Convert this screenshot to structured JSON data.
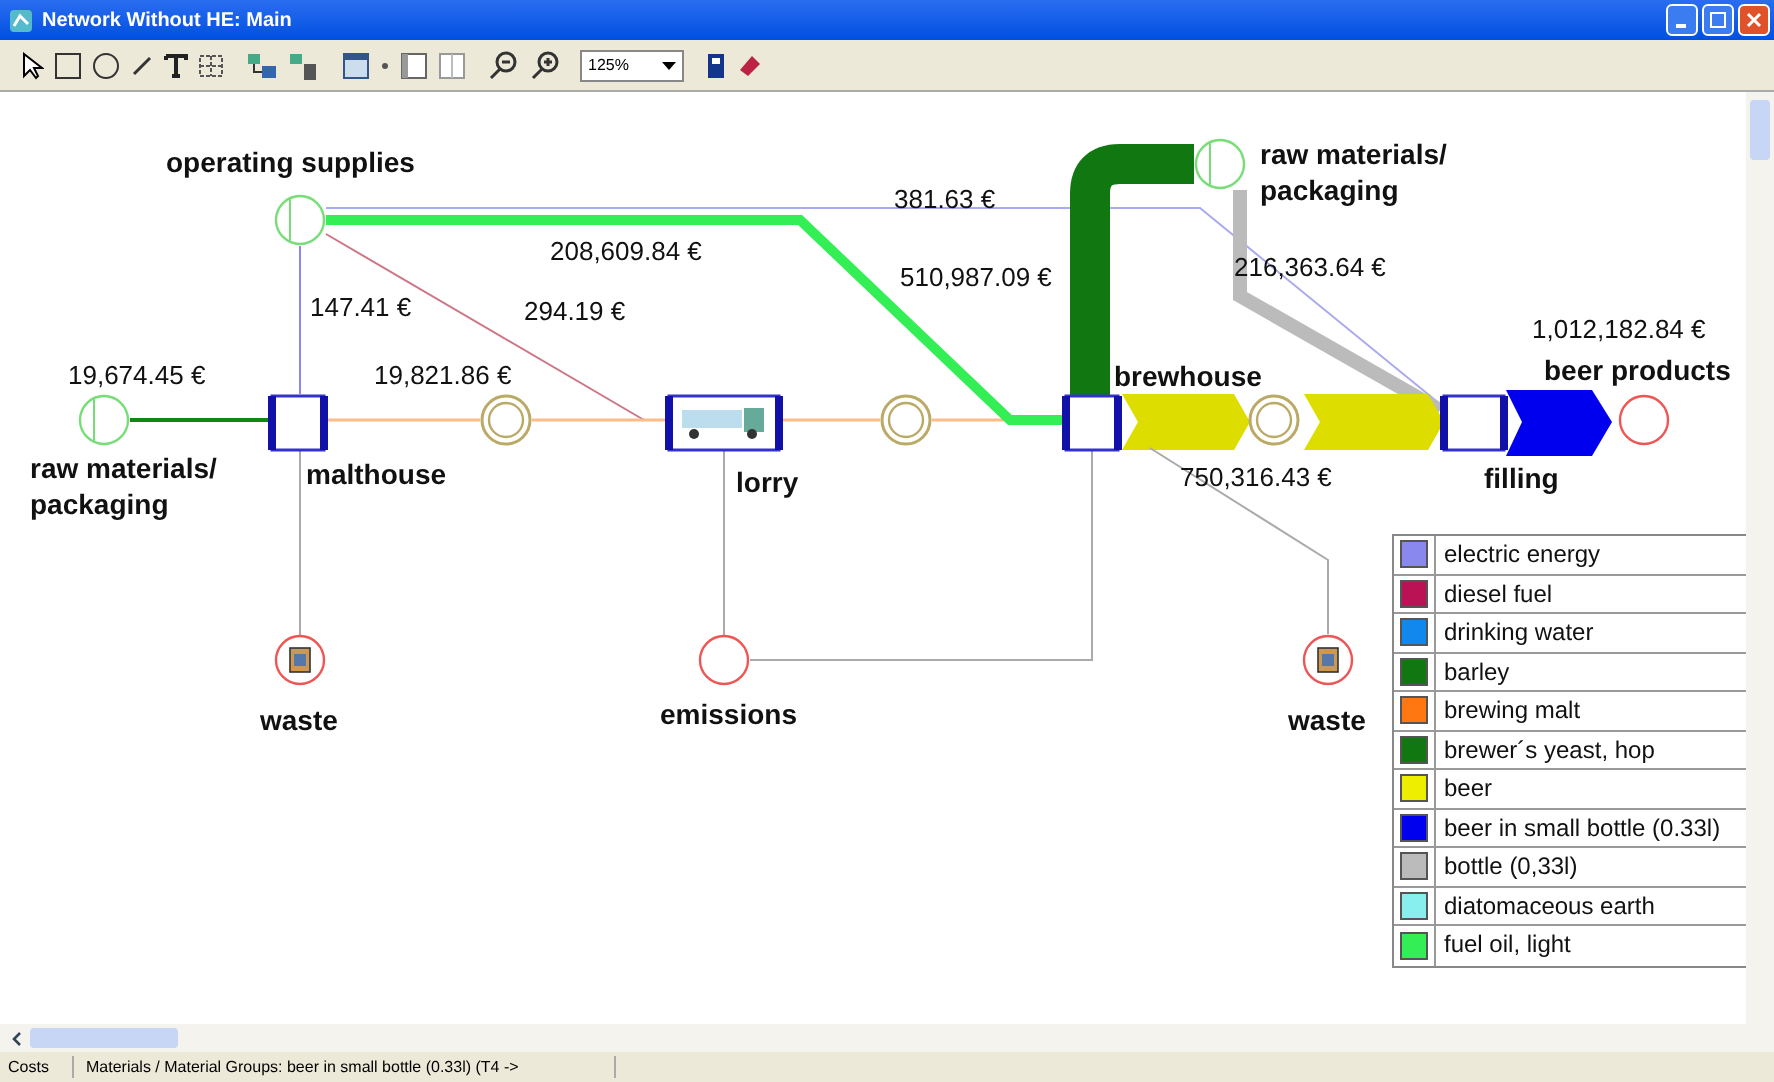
{
  "window": {
    "title": "Network Without HE: Main"
  },
  "toolbar": {
    "zoom": "125%"
  },
  "diagram": {
    "nodes": [
      {
        "kind": "source",
        "label": [
          "operating supplies"
        ]
      },
      {
        "kind": "source",
        "label": [
          "raw materials/",
          "packaging"
        ]
      },
      {
        "kind": "process",
        "label": [
          "malthouse"
        ]
      },
      {
        "kind": "waste",
        "label": [
          "waste"
        ]
      },
      {
        "kind": "connection"
      },
      {
        "kind": "process",
        "label": [
          "lorry"
        ]
      },
      {
        "kind": "sink",
        "label": [
          "emissions"
        ]
      },
      {
        "kind": "connection"
      },
      {
        "kind": "process",
        "label": [
          "brewhouse"
        ]
      },
      {
        "kind": "connection"
      },
      {
        "kind": "source",
        "label": [
          "raw materials/",
          "packaging"
        ]
      },
      {
        "kind": "process",
        "label": [
          "filling"
        ]
      },
      {
        "kind": "sink",
        "label": [
          "beer products"
        ]
      },
      {
        "kind": "waste",
        "label": [
          "waste"
        ]
      }
    ],
    "flows": [
      {
        "value": "19,674.45 €",
        "color": "#118811"
      },
      {
        "value": "147.41 €",
        "color": "#8888ee"
      },
      {
        "value": "19,821.86 €",
        "color": "#ffbb88"
      },
      {
        "value": "294.19 €",
        "color": "#cc7788"
      },
      {
        "color": "#ffbb88"
      },
      {
        "color": "#ffbb88"
      },
      {
        "color": "#ffbb88"
      },
      {
        "value": "208,609.84 €",
        "color": "#33ee55"
      },
      {
        "value": "381.63 €",
        "color": "#aaaaee"
      },
      {
        "value": "510,987.09 €",
        "color": "#117711"
      },
      {
        "value": "216,363.64 €",
        "color": "#bbbbbb"
      },
      {
        "color": "#dddd00"
      },
      {
        "value": "750,316.43 €",
        "color": "#dddd00"
      },
      {
        "value": "1,012,182.84 €",
        "color": "#0000ee"
      },
      {
        "color": "#aaaaaa"
      },
      {
        "color": "#aaaaaa"
      },
      {
        "color": "#aaaaaa"
      },
      {
        "color": "#aaaaaa"
      }
    ]
  },
  "legend": [
    {
      "label": "electric energy",
      "color": "#8888ee"
    },
    {
      "label": "diesel fuel",
      "color": "#bb1155"
    },
    {
      "label": "drinking water",
      "color": "#1188ee"
    },
    {
      "label": "barley",
      "color": "#117711"
    },
    {
      "label": "brewing malt",
      "color": "#ff7711"
    },
    {
      "label": "brewer´s yeast, hop",
      "color": "#117711"
    },
    {
      "label": "beer",
      "color": "#eeee00"
    },
    {
      "label": "beer in small bottle (0.33l)",
      "color": "#0000ee"
    },
    {
      "label": "bottle (0,33l)",
      "color": "#bbbbbb"
    },
    {
      "label": "diatomaceous earth",
      "color": "#88eeee"
    },
    {
      "label": "fuel oil, light",
      "color": "#33ee55"
    }
  ],
  "status_bar": [
    "Costs",
    "Materials / Material Groups: beer in small bottle (0.33l)  (T4 ->"
  ]
}
